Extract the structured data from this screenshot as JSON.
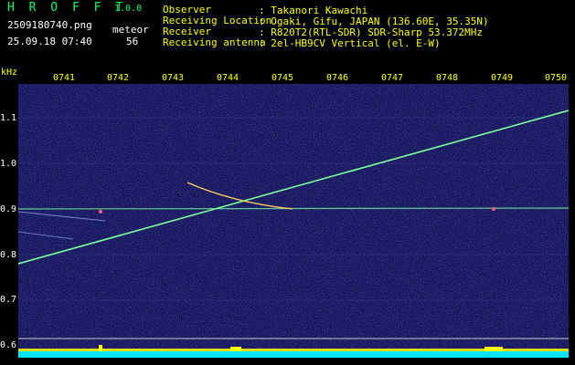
{
  "header": {
    "app_name": "H R O F F T",
    "version": "1.0.0",
    "filename": "2509180740.png",
    "datetime": "25.09.18 07:40",
    "meteor_label": "meteor",
    "meteor_count": "56",
    "observer_label": "Observer",
    "observer_value": ": Takanori Kawachi",
    "location_label": "Receiving Location",
    "location_value": ": Ogaki, Gifu, JAPAN (136.60E, 35.35N)",
    "receiver_label": "Receiver",
    "receiver_value": ": R820T2(RTL-SDR) SDR-Sharp 53.372MHz",
    "antenna_label": "Receiving antenna",
    "antenna_value": ": 2el-HB9CV Vertical (el. E-W)"
  },
  "y_axis": {
    "unit": "kHz",
    "ticks": [
      "1.1",
      "1.0",
      "0.9",
      "0.8",
      "0.7",
      "0.6"
    ]
  },
  "x_axis": {
    "ticks": [
      "0741",
      "0742",
      "0743",
      "0744",
      "0745",
      "0746",
      "0747",
      "0748",
      "0749",
      "0750"
    ]
  },
  "colors": {
    "background": "#000000",
    "spectrogram": "#14145a",
    "header_text": "#ffffff",
    "accent_yellow": "#ffff00",
    "accent_green": "#00ff66",
    "trace": "#7cff9a",
    "level_bar": "#00e5ff"
  }
}
